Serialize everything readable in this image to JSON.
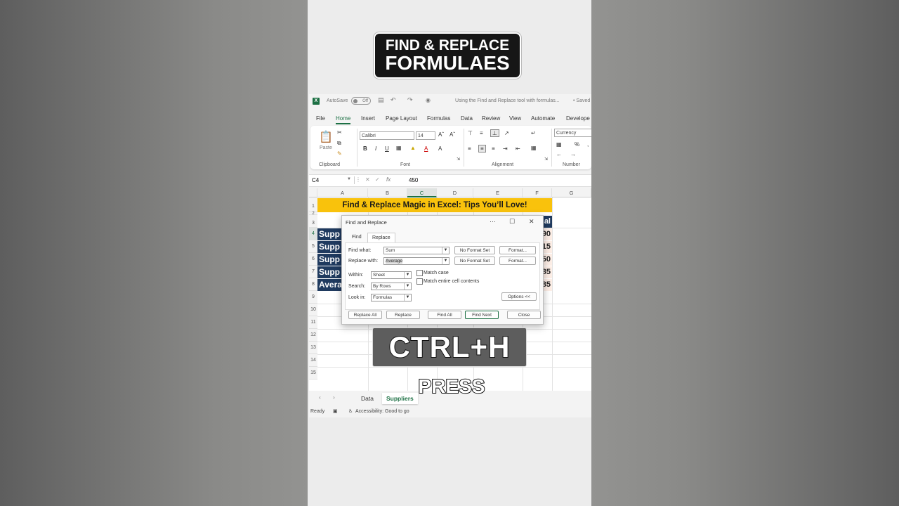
{
  "video": {
    "title_line1": "FIND & REPLACE",
    "title_line2": "FORMULAES",
    "shortcut": "CTRL+H",
    "caption": "PRESS"
  },
  "excel": {
    "autosave_label": "AutoSave",
    "autosave_state": "Off",
    "doc_title": "Using the Find and Replace tool with formulas...",
    "save_state": "• Saved",
    "menu": [
      "File",
      "Home",
      "Insert",
      "Page Layout",
      "Formulas",
      "Data",
      "Review",
      "View",
      "Automate",
      "Develope"
    ],
    "active_menu": "Home",
    "ribbon": {
      "paste_label": "Paste",
      "clipboard_label": "Clipboard",
      "font_name": "Calibri",
      "font_size": "14",
      "font_label": "Font",
      "alignment_label": "Alignment",
      "number_format": "Currency",
      "number_label": "Number"
    },
    "formula_bar": {
      "name_box": "C4",
      "fx": "fx",
      "value": "450"
    },
    "columns": [
      "A",
      "B",
      "C",
      "D",
      "E",
      "F",
      "G"
    ],
    "rows": [
      "1",
      "2",
      "3",
      "4",
      "5",
      "6",
      "7",
      "8",
      "9",
      "10",
      "11",
      "12",
      "13",
      "14",
      "15"
    ],
    "banner": "Find & Replace Magic in Excel: Tips You’ll Love!",
    "col_a_cells": [
      "Supp",
      "Supp",
      "Supp",
      "Supp",
      "Avera"
    ],
    "col_f_header": "al",
    "col_f_values": [
      "90",
      "15",
      "50",
      "85",
      "85"
    ],
    "sheet_tabs": [
      "Data",
      "Suppliers"
    ],
    "active_sheet": "Suppliers",
    "status_ready": "Ready",
    "status_accessibility": "Accessibility: Good to go"
  },
  "dialog": {
    "title": "Find and Replace",
    "tabs": [
      "Find",
      "Replace"
    ],
    "active_tab": "Replace",
    "find_what_label": "Find what:",
    "find_what_value": "Sum",
    "replace_with_label": "Replace with:",
    "replace_with_value": "Average",
    "no_format_set": "No Format Set",
    "format_button": "Format...",
    "within_label": "Within:",
    "within_value": "Sheet",
    "search_label": "Search:",
    "search_value": "By Rows",
    "look_in_label": "Look in:",
    "look_in_value": "Formulas",
    "match_case": "Match case",
    "match_entire": "Match entire cell contents",
    "options_button": "Options <<",
    "buttons": {
      "replace_all": "Replace All",
      "replace": "Replace",
      "find_all": "Find All",
      "find_next": "Find Next",
      "close": "Close"
    }
  }
}
